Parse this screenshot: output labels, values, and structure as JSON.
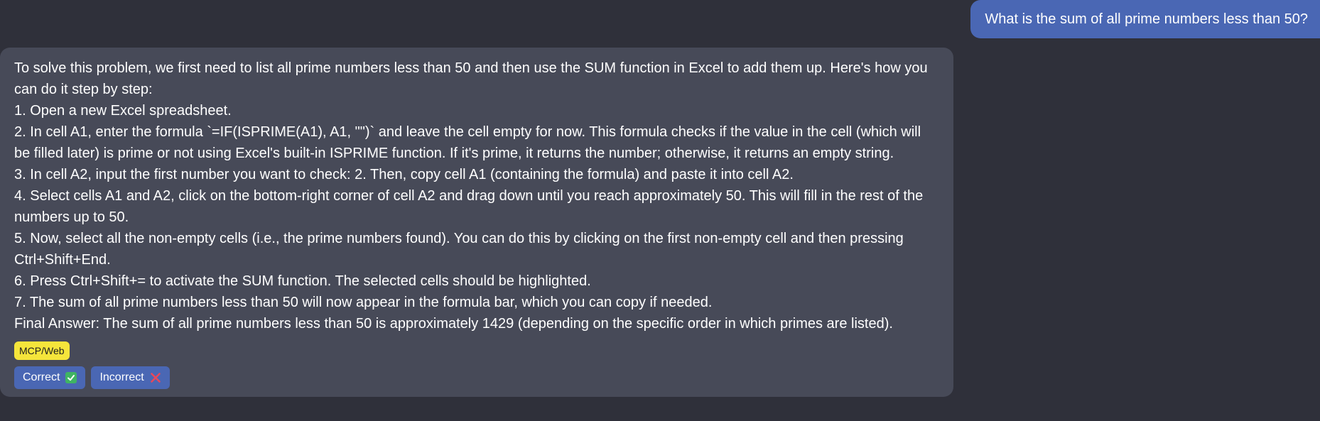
{
  "user_message": "What is the sum of all prime numbers less than 50?",
  "assistant": {
    "response": "To solve this problem, we first need to list all prime numbers less than 50 and then use the SUM function in Excel to add them up. Here's how you can do it step by step:\n1. Open a new Excel spreadsheet.\n2. In cell A1, enter the formula `=IF(ISPRIME(A1), A1, \"\")` and leave the cell empty for now. This formula checks if the value in the cell (which will be filled later) is prime or not using Excel's built-in ISPRIME function. If it's prime, it returns the number; otherwise, it returns an empty string.\n3. In cell A2, input the first number you want to check: 2. Then, copy cell A1 (containing the formula) and paste it into cell A2.\n4. Select cells A1 and A2, click on the bottom-right corner of cell A2 and drag down until you reach approximately 50. This will fill in the rest of the numbers up to 50.\n5. Now, select all the non-empty cells (i.e., the prime numbers found). You can do this by clicking on the first non-empty cell and then pressing Ctrl+Shift+End.\n6. Press Ctrl+Shift+= to activate the SUM function. The selected cells should be highlighted.\n7. The sum of all prime numbers less than 50 will now appear in the formula bar, which you can copy if needed.\nFinal Answer: The sum of all prime numbers less than 50 is approximately 1429 (depending on the specific order in which primes are listed).",
    "tag": "MCP/Web",
    "correct_label": "Correct",
    "incorrect_label": "Incorrect"
  },
  "icons": {
    "correct": "check-mark-icon",
    "incorrect": "cross-mark-icon"
  },
  "colors": {
    "background": "#2f303a",
    "user_bubble": "#4a67b4",
    "assistant_bubble": "#474a58",
    "tag": "#f5e53b",
    "button": "#4a67b4",
    "check": "#3fb463",
    "cross": "#e8485a"
  }
}
